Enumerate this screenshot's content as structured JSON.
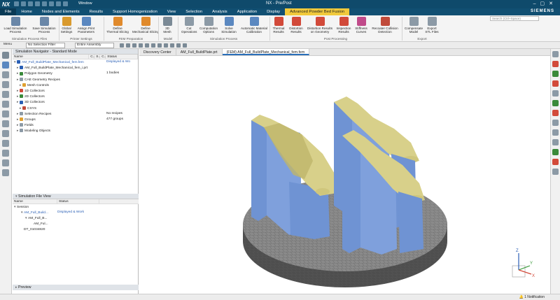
{
  "app": {
    "logo": "NX",
    "window_menu": "Window",
    "title": "NX - Pre/Post",
    "brand": "SIEMENS",
    "search_placeholder": "Search (Ctrl+Space)"
  },
  "menu": [
    "File",
    "Home",
    "Nodes and Elements",
    "Results",
    "Support Homogenization",
    "View",
    "Selection",
    "Analysis",
    "Application",
    "Display",
    "Advanced Powder Bed Fusion"
  ],
  "ribbon": {
    "buttons": [
      {
        "label": "Load Simulation\nProcess",
        "color": "#6a87a8"
      },
      {
        "label": "Save Simulation\nProcess",
        "color": "#6a87a8"
      },
      {
        "label": "Global\nSettings",
        "color": "#d99a2e"
      },
      {
        "label": "Assign Print\nParameters",
        "color": "#5b88c0"
      },
      {
        "label": "Define\nThermal Slicing",
        "color": "#e08a2c"
      },
      {
        "label": "Define\nMechanical Slicing",
        "color": "#e08a2c"
      },
      {
        "label": "3D\nMesh",
        "color": "#7b8a96"
      },
      {
        "label": "Cut\nOperations",
        "color": "#8c9aa6"
      },
      {
        "label": "Computation\nOptions",
        "color": "#8c9aa6"
      },
      {
        "label": "Solve\nSimulation",
        "color": "#5b88c0"
      },
      {
        "label": "Automatic Material\nCalibration",
        "color": "#5b88c0"
      },
      {
        "label": "Thermal\nResults",
        "color": "#d24a3a"
      },
      {
        "label": "Distortion\nResults",
        "color": "#d24a3a"
      },
      {
        "label": "Distortion Results\non Geometry",
        "color": "#d24a3a"
      },
      {
        "label": "Inspection\nResults",
        "color": "#d24a3a"
      },
      {
        "label": "Stiffness\nCurves",
        "color": "#c04a8a"
      },
      {
        "label": "Recoater Collision\nDetection",
        "color": "#c04a3a"
      },
      {
        "label": "Compensate\nModel",
        "color": "#8c9aa6"
      },
      {
        "label": "Export\nSTL Files",
        "color": "#8c9aa6"
      }
    ],
    "groups": [
      "Simulation Process Files",
      "Printer Settings",
      "FEM Preparation",
      "Model",
      "Simulation Process",
      "Post Processing",
      "Export"
    ]
  },
  "toolbar2": {
    "menu": "Menu",
    "filter": "No Selection Filter",
    "assembly": "Entire Assembly"
  },
  "navigator": {
    "title": "Simulation Navigator - Standard Mode",
    "columns": [
      "Name",
      "C..",
      "S..",
      "C..",
      "Status"
    ],
    "rows": [
      {
        "name": "AM_Full_BuildPlate_Mechanical_fem.fem",
        "status": "Displayed & Wo",
        "color": "#2a5fb5"
      },
      {
        "name": "AM_Full_BuildPlate_Mechanical_fem_i.prt",
        "status": "",
        "color": "#2a5fb5"
      },
      {
        "name": "Polygon Geometry",
        "status": "1 bodies",
        "color": "#3a8a3a"
      },
      {
        "name": "CAE Geometry Recipes",
        "status": "",
        "color": "#8c9aa6"
      },
      {
        "name": "Mesh Controls",
        "status": "",
        "color": "#e0a030"
      },
      {
        "name": "1D Collectors",
        "status": "",
        "color": "#d24a3a"
      },
      {
        "name": "2D Collectors",
        "status": "",
        "color": "#3a8a3a"
      },
      {
        "name": "3D Collectors",
        "status": "",
        "color": "#2a5fb5"
      },
      {
        "name": "CSYS",
        "status": "",
        "color": "#c04a3a"
      },
      {
        "name": "Selection Recipes",
        "status": "No recipes",
        "color": "#8c9aa6"
      },
      {
        "name": "Groups",
        "status": "477 groups",
        "color": "#e0a030"
      },
      {
        "name": "Fields",
        "status": "",
        "color": "#8c9aa6"
      },
      {
        "name": "Modeling Objects",
        "status": "",
        "color": "#8c9aa6"
      }
    ]
  },
  "file_view": {
    "title": "Simulation File View",
    "columns": [
      "Name",
      "Status"
    ],
    "rows": [
      {
        "name": "Session",
        "status": ""
      },
      {
        "name": "AM_Full_Build...",
        "status": "Displayed & Work"
      },
      {
        "name": "AM_Full_B...",
        "status": ""
      },
      {
        "name": "AM_Ful...",
        "status": ""
      },
      {
        "name": "DT_01034820",
        "status": ""
      }
    ]
  },
  "preview": "Preview",
  "tabs": [
    "Discovery Center",
    "AM_Full_BuildPlate.prt",
    "(FEM) AM_Full_BuildPlate_Mechanical_fem.fem"
  ],
  "triad": {
    "z": "Z",
    "y": "Y",
    "x": "X"
  },
  "status": {
    "notification": "1 Notification"
  }
}
